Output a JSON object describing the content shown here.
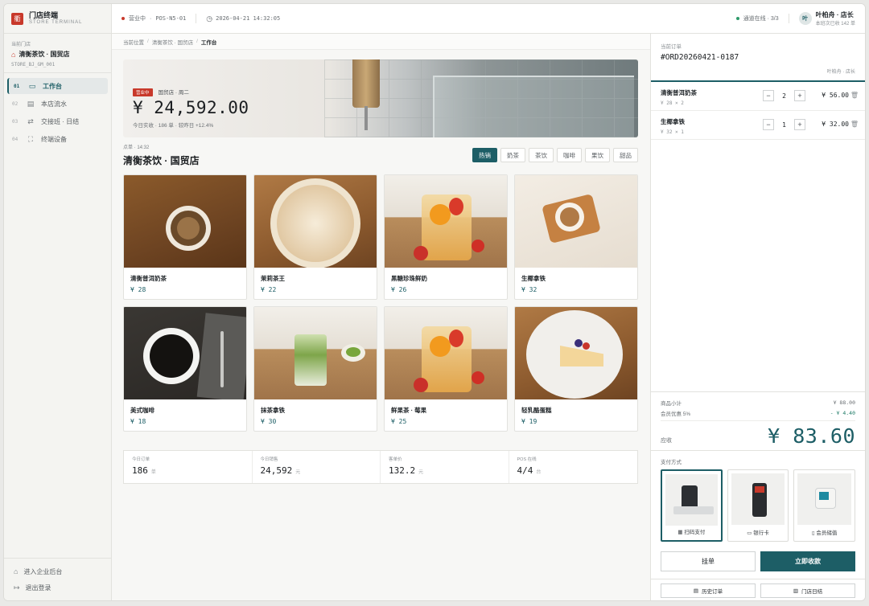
{
  "colors": {
    "accent": "#1d5e66",
    "brand": "#c8392b",
    "online": "#2e9a6a"
  },
  "brand": {
    "logo": "衢",
    "name": "门店终端",
    "sub": "STORE TERMINAL"
  },
  "store": {
    "caption": "当前门店",
    "name": "清衡茶饮 · 国贸店",
    "code": "STORE_BJ_GM_001"
  },
  "nav": [
    {
      "num": "01",
      "icon": "monitor-icon",
      "label": "工作台"
    },
    {
      "num": "02",
      "icon": "document-icon",
      "label": "本店流水"
    },
    {
      "num": "03",
      "icon": "user-switch-icon",
      "label": "交接班 · 日结"
    },
    {
      "num": "04",
      "icon": "device-icon",
      "label": "终端设备"
    }
  ],
  "side_bottom": [
    {
      "icon": "building-icon",
      "label": "进入企业后台"
    },
    {
      "icon": "logout-icon",
      "label": "退出登录"
    }
  ],
  "topbar": {
    "status": "营业中",
    "pos": "POS-N5-01",
    "datetime": "2026-04-21 14:32:05",
    "channel": "通道在线 · 3/3",
    "user_initial": "叶",
    "user_name": "叶柏舟 · 店长",
    "user_sub": "本班次已收 142 单"
  },
  "breadcrumb": {
    "prefix": "当前位置",
    "level1": "清衡茶饮 · 国贸店",
    "current": "工作台"
  },
  "hero": {
    "badge": "营业中",
    "store": "国贸店 · 周二",
    "amount": "¥ 24,592.00",
    "stats": "今日实收 · 186 单 · 较昨日 +12.4%"
  },
  "section": {
    "time": "点单 · 14:32",
    "title": "清衡茶饮 · 国贸店"
  },
  "categories": [
    {
      "label": "热销",
      "active": true
    },
    {
      "label": "奶茶",
      "active": false
    },
    {
      "label": "茶饮",
      "active": false
    },
    {
      "label": "咖啡",
      "active": false
    },
    {
      "label": "果饮",
      "active": false
    },
    {
      "label": "甜品",
      "active": false
    }
  ],
  "products": [
    {
      "name": "清衡普洱奶茶",
      "price": "¥ 28"
    },
    {
      "name": "茉莉茶王",
      "price": "¥ 22"
    },
    {
      "name": "黑糖珍珠鲜奶",
      "price": "¥ 26"
    },
    {
      "name": "生椰拿铁",
      "price": "¥ 32"
    },
    {
      "name": "美式咖啡",
      "price": "¥ 18"
    },
    {
      "name": "抹茶拿铁",
      "price": "¥ 30"
    },
    {
      "name": "鲜果茶 · 莓果",
      "price": "¥ 25"
    },
    {
      "name": "轻乳酪蛋糕",
      "price": "¥ 19"
    }
  ],
  "stats": [
    {
      "label": "今日订单",
      "value": "186",
      "unit": "单"
    },
    {
      "label": "今日销售",
      "value": "24,592",
      "unit": "元"
    },
    {
      "label": "客单价",
      "value": "132.2",
      "unit": "元"
    },
    {
      "label": "POS 在线",
      "value": "4/4",
      "unit": "台"
    }
  ],
  "order": {
    "label": "当前订单",
    "id": "#ORD20260421-0187",
    "cashier": "叶柏舟 · 店长",
    "items": [
      {
        "name": "清衡普洱奶茶",
        "sub": "¥ 28 × 2",
        "qty": "2",
        "total": "¥ 56.00"
      },
      {
        "name": "生椰拿铁",
        "sub": "¥ 32 × 1",
        "qty": "1",
        "total": "¥ 32.00"
      }
    ],
    "subtotal_label": "商品小计",
    "subtotal": "¥ 88.00",
    "discount_label": "会员优惠 5%",
    "discount": "- ¥ 4.40",
    "due_label": "应收",
    "due": "¥ 83.60"
  },
  "payment": {
    "label": "支付方式",
    "options": [
      {
        "icon": "qr-icon",
        "label": "扫码支付",
        "active": true
      },
      {
        "icon": "card-icon",
        "label": "银行卡",
        "active": false
      },
      {
        "icon": "phone-icon",
        "label": "会员储值",
        "active": false
      }
    ]
  },
  "actions": {
    "hold": "挂单",
    "checkout": "立即收款",
    "history": "历史订单",
    "daily": "门店日结"
  }
}
